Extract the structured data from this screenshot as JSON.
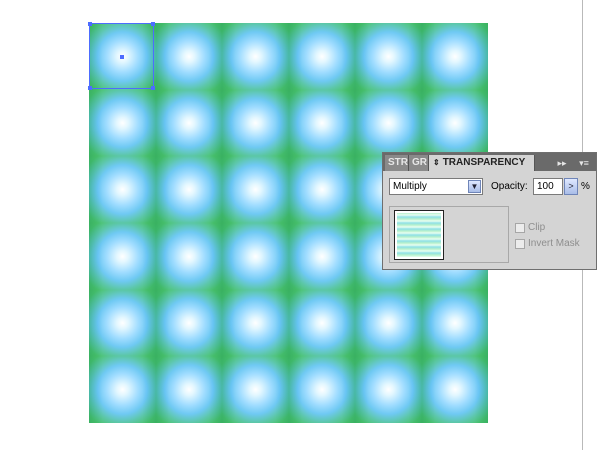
{
  "panel": {
    "tabs": [
      {
        "label": "STR"
      },
      {
        "label": "GR"
      },
      {
        "label": "TRANSPARENCY",
        "prefix": "⇕"
      }
    ],
    "collapse_icon": "▸▸",
    "menu_icon": "▾≡",
    "blend_mode": "Multiply",
    "opacity_label": "Opacity:",
    "opacity_value": "100",
    "opacity_unit": "%",
    "clip_label": "Clip",
    "invert_mask_label": "Invert Mask"
  },
  "colors": {
    "tile_green": "#48c060",
    "tile_blue": "#6fc9f3",
    "tile_center": "#ffffff",
    "selection": "#4d6cff",
    "panel_bg": "#d4d4d4"
  }
}
